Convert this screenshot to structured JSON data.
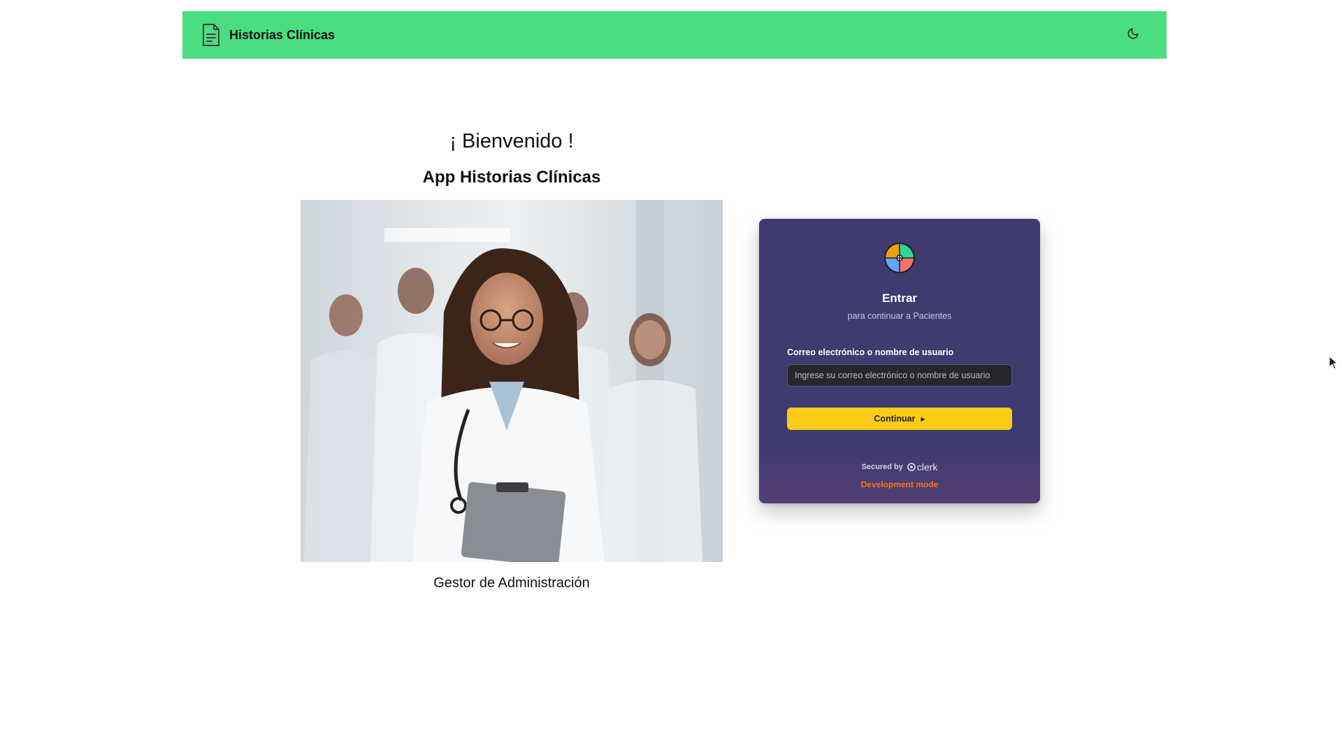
{
  "header": {
    "title": "Historias Clínicas",
    "brand_icon": "document-icon",
    "theme_toggle_icon": "moon-icon",
    "background_color": "#4ade80"
  },
  "hero": {
    "welcome": "¡ Bienvenido !",
    "subtitle": "App Historias Clínicas",
    "photo_subject": "medical-team-photo",
    "caption": "Gestor de Administración"
  },
  "login_card": {
    "title": "Entrar",
    "subtitle": "para continuar a Pacientes",
    "field_label": "Correo electrónico o nombre de usuario",
    "field_placeholder": "Ingrese su correo electrónico o nombre de usuario",
    "field_value": "",
    "continue_label": "Continuar",
    "secured_by": "Secured by",
    "provider": "clerk",
    "dev_mode": "Development mode",
    "background_color": "#3f3a70",
    "button_color": "#facc15",
    "dev_mode_color": "#f97316"
  }
}
